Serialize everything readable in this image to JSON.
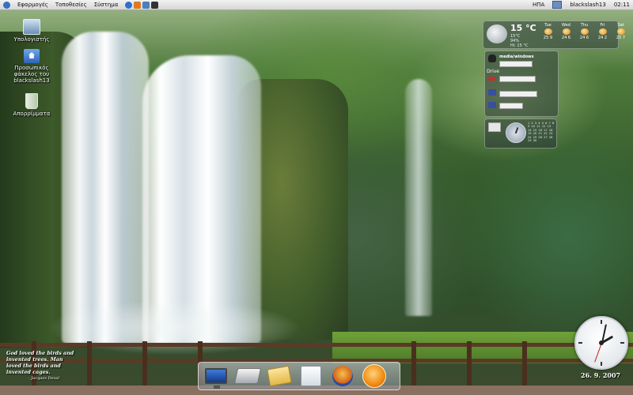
{
  "top_panel": {
    "menus": [
      "Εφαρμογές",
      "Τοποθεσίες",
      "Σύστημα"
    ],
    "launcher_icons": [
      "help-icon",
      "web-browser-icon",
      "mail-icon",
      "terminal-icon"
    ],
    "keyboard_layout": "ΗΠΑ",
    "username": "blackslash13",
    "time": "02:11"
  },
  "desktop_icons": [
    {
      "label": "Υπολογιστής",
      "icon": "computer-icon"
    },
    {
      "label": "Προσωπικός φάκελος του blackslash13",
      "icon": "home-folder-icon"
    },
    {
      "label": "Απορρίμματα",
      "icon": "trash-icon"
    }
  ],
  "weather": {
    "temperature": "15 °C",
    "details": [
      "15°C",
      "94%",
      "Hi: 15 °C"
    ],
    "forecast": [
      {
        "day": "Tue",
        "hi_lo": "25  9"
      },
      {
        "day": "Wed",
        "hi_lo": "24  6"
      },
      {
        "day": "Thu",
        "hi_lo": "24  6"
      },
      {
        "day": "Fri",
        "hi_lo": "24  2"
      },
      {
        "day": "Sat",
        "hi_lo": "25  7"
      }
    ]
  },
  "system_monitor": {
    "header": "media/windows",
    "drive_label": "Drive"
  },
  "calendar": {
    "grid_text": "1 2 3 4 5 6 7 8 9 10 11 12 13 14 15 16 17 18 19 20 21 22 23 24 25 26 27 28 29 30"
  },
  "clock": {
    "date": "26. 9. 2007"
  },
  "quote": {
    "text": "God loved the birds and invented trees. Man loved the birds and invented cages.",
    "author": "- Jacques Deval"
  },
  "dock": {
    "items": [
      {
        "icon": "monitor-icon"
      },
      {
        "icon": "drive-icon"
      },
      {
        "icon": "folder-icon"
      },
      {
        "icon": "control-panel-icon"
      },
      {
        "icon": "app-figure-icon"
      },
      {
        "icon": "audio-orb-icon"
      }
    ]
  }
}
